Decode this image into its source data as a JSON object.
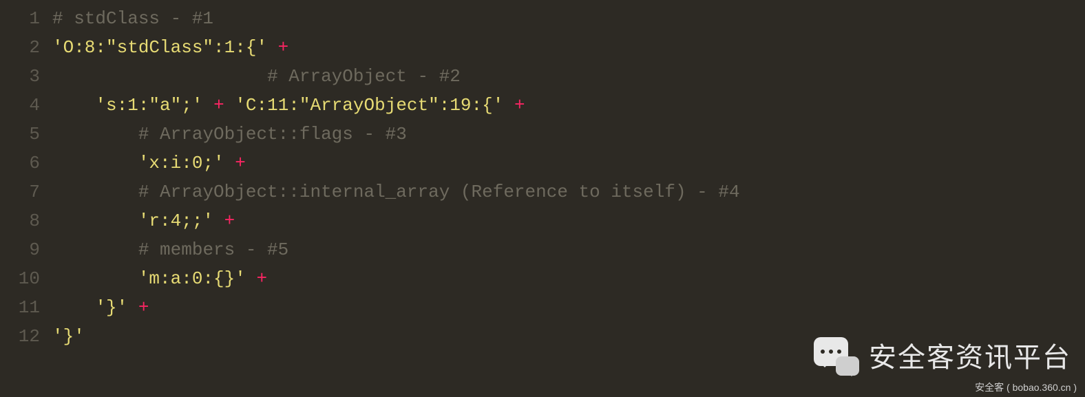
{
  "lines": [
    {
      "num": "1",
      "indent": "",
      "tokens": [
        {
          "cls": "tok-comment",
          "t": "# stdClass - #1"
        }
      ]
    },
    {
      "num": "2",
      "indent": "",
      "tokens": [
        {
          "cls": "tok-string",
          "t": "'O:8:\"stdClass\":1:{'"
        },
        {
          "cls": "",
          "t": " "
        },
        {
          "cls": "tok-op",
          "t": "+"
        }
      ]
    },
    {
      "num": "3",
      "indent": "                    ",
      "tokens": [
        {
          "cls": "tok-comment",
          "t": "# ArrayObject - #2"
        }
      ]
    },
    {
      "num": "4",
      "indent": "    ",
      "tokens": [
        {
          "cls": "tok-string",
          "t": "'s:1:\"a\";'"
        },
        {
          "cls": "",
          "t": " "
        },
        {
          "cls": "tok-op",
          "t": "+"
        },
        {
          "cls": "",
          "t": " "
        },
        {
          "cls": "tok-string",
          "t": "'C:11:\"ArrayObject\":19:{'"
        },
        {
          "cls": "",
          "t": " "
        },
        {
          "cls": "tok-op",
          "t": "+"
        }
      ]
    },
    {
      "num": "5",
      "indent": "        ",
      "tokens": [
        {
          "cls": "tok-comment",
          "t": "# ArrayObject::flags - #3"
        }
      ]
    },
    {
      "num": "6",
      "indent": "        ",
      "tokens": [
        {
          "cls": "tok-string",
          "t": "'x:i:0;'"
        },
        {
          "cls": "",
          "t": " "
        },
        {
          "cls": "tok-op",
          "t": "+"
        }
      ]
    },
    {
      "num": "7",
      "indent": "        ",
      "tokens": [
        {
          "cls": "tok-comment",
          "t": "# ArrayObject::internal_array (Reference to itself) - #4"
        }
      ]
    },
    {
      "num": "8",
      "indent": "        ",
      "tokens": [
        {
          "cls": "tok-string",
          "t": "'r:4;;'"
        },
        {
          "cls": "",
          "t": " "
        },
        {
          "cls": "tok-op",
          "t": "+"
        }
      ]
    },
    {
      "num": "9",
      "indent": "        ",
      "tokens": [
        {
          "cls": "tok-comment",
          "t": "# members - #5"
        }
      ]
    },
    {
      "num": "10",
      "indent": "        ",
      "tokens": [
        {
          "cls": "tok-string",
          "t": "'m:a:0:{}'"
        },
        {
          "cls": "",
          "t": " "
        },
        {
          "cls": "tok-op",
          "t": "+"
        }
      ]
    },
    {
      "num": "11",
      "indent": "    ",
      "tokens": [
        {
          "cls": "tok-string",
          "t": "'}'"
        },
        {
          "cls": "",
          "t": " "
        },
        {
          "cls": "tok-op",
          "t": "+"
        }
      ]
    },
    {
      "num": "12",
      "indent": "",
      "tokens": [
        {
          "cls": "tok-string",
          "t": "'}'"
        }
      ]
    }
  ],
  "watermark": {
    "title": "安全客资讯平台",
    "subtitle": "安全客 ( bobao.360.cn )"
  }
}
